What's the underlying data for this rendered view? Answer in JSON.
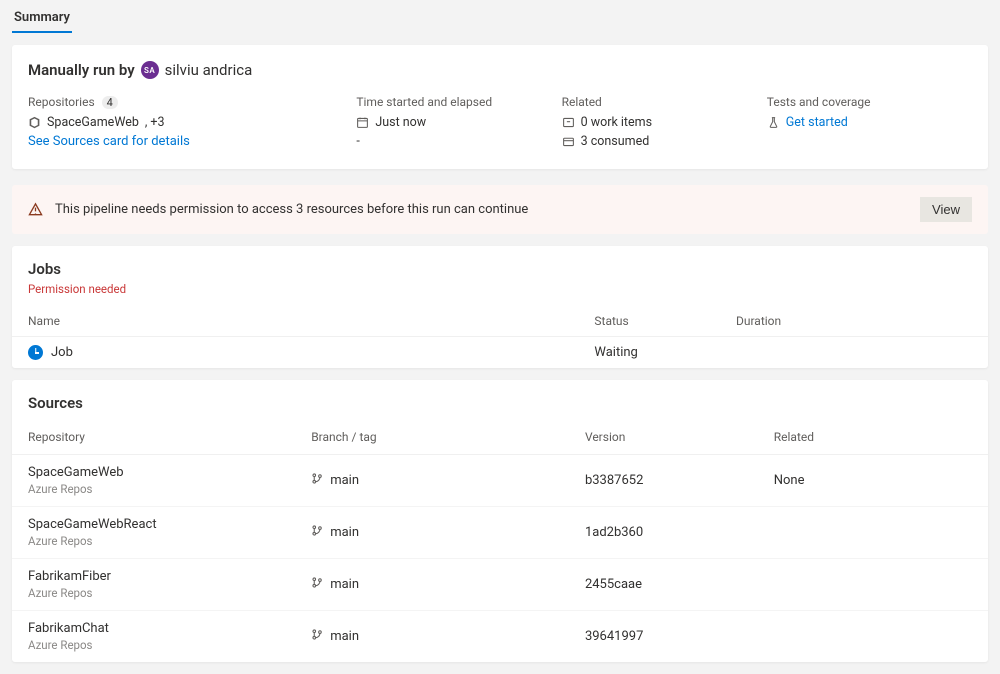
{
  "tabs": {
    "summary": "Summary"
  },
  "overview": {
    "run_by_label": "Manually run by",
    "avatar_initials": "SA",
    "username": "silviu andrica",
    "repos": {
      "heading": "Repositories",
      "count": "4",
      "primary": "SpaceGameWeb",
      "extra": ", +3",
      "see_sources": "See Sources card for details"
    },
    "time": {
      "heading": "Time started and elapsed",
      "started": "Just now",
      "elapsed": "-"
    },
    "related": {
      "heading": "Related",
      "work_items": "0 work items",
      "consumed": "3 consumed"
    },
    "tests": {
      "heading": "Tests and coverage",
      "get_started": "Get started"
    }
  },
  "warning": {
    "message": "This pipeline needs permission to access 3 resources before this run can continue",
    "view": "View"
  },
  "jobs": {
    "title": "Jobs",
    "permission_needed": "Permission needed",
    "columns": {
      "name": "Name",
      "status": "Status",
      "duration": "Duration"
    },
    "rows": [
      {
        "name": "Job",
        "status": "Waiting",
        "duration": ""
      }
    ]
  },
  "sources": {
    "title": "Sources",
    "columns": {
      "repository": "Repository",
      "branch": "Branch / tag",
      "version": "Version",
      "related": "Related"
    },
    "rows": [
      {
        "name": "SpaceGameWeb",
        "provider": "Azure Repos",
        "branch": "main",
        "version": "b3387652",
        "related": "None"
      },
      {
        "name": "SpaceGameWebReact",
        "provider": "Azure Repos",
        "branch": "main",
        "version": "1ad2b360",
        "related": ""
      },
      {
        "name": "FabrikamFiber",
        "provider": "Azure Repos",
        "branch": "main",
        "version": "2455caae",
        "related": ""
      },
      {
        "name": "FabrikamChat",
        "provider": "Azure Repos",
        "branch": "main",
        "version": "39641997",
        "related": ""
      }
    ]
  }
}
